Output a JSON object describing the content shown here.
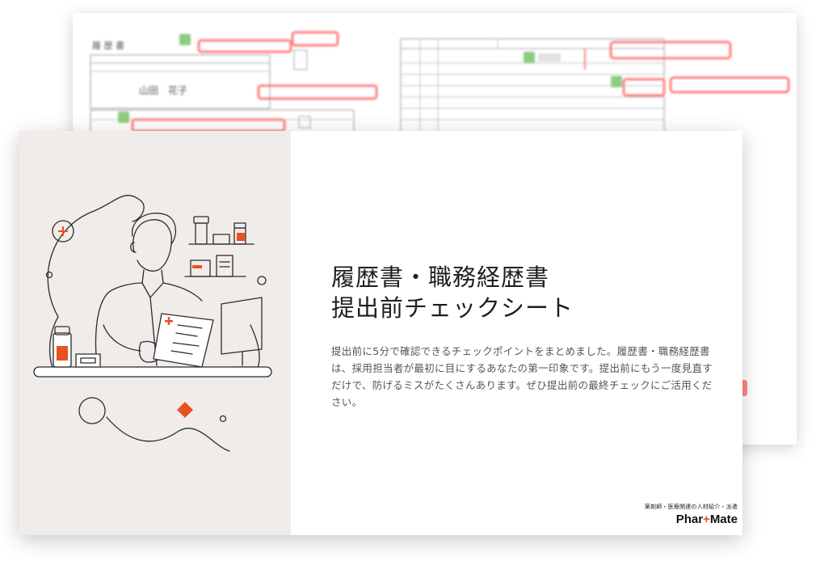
{
  "cover": {
    "title_line1": "履歴書・職務経歴書",
    "title_line2": "提出前チェックシート",
    "description": "提出前に5分で確認できるチェックポイントをまとめました。履歴書・職務経歴書は、採用担当者が最初に目にするあなたの第一印象です。提出前にもう一度見直すだけで、防げるミスがたくさんあります。ぜひ提出前の最終チェックにご活用ください。"
  },
  "back_sheet": {
    "resume_heading": "履 歴 書",
    "resume_name": "山田　花子"
  },
  "brand": {
    "tagline": "薬剤師・医療関連の人材紹介・派遣",
    "logo_left": "Phar",
    "logo_plus": "+",
    "logo_right": "Mate"
  },
  "colors": {
    "accent": "#e8521c",
    "panel_bg": "#f0ecea",
    "highlight_red": "#ff6b6b",
    "check_green": "#7cc36a"
  },
  "illustration": {
    "subject": "pharmacist-reading-document-icon"
  }
}
